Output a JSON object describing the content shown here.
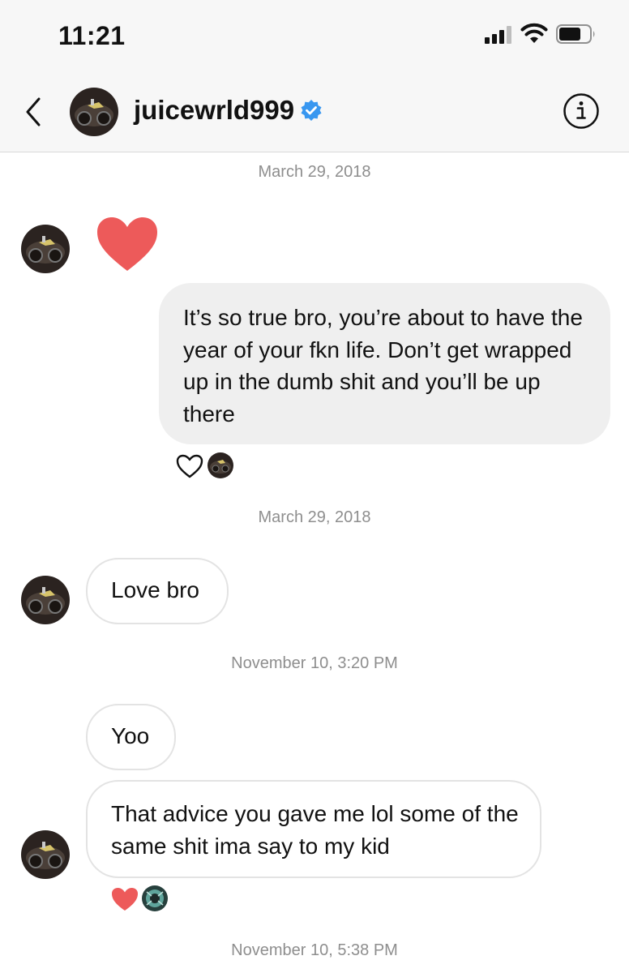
{
  "status_bar": {
    "time": "11:21"
  },
  "header": {
    "username": "juicewrld999",
    "verified": true,
    "back_icon": "chevron-left-icon",
    "info_icon": "info-icon"
  },
  "conversation": {
    "dates": [
      "March 29, 2018",
      "March 29, 2018",
      "November 10, 3:20 PM",
      "November 10, 5:38 PM"
    ],
    "messages": [
      {
        "sender": "them",
        "type": "heart",
        "icon": "heart-icon"
      },
      {
        "sender": "me",
        "type": "text",
        "text": "It’s so true bro, you’re about to have the year of your fkn life. Don’t get wrapped up in the dumb shit and you’ll be up there",
        "reaction": "heart-outline"
      },
      {
        "sender": "them",
        "type": "text",
        "text": "Love bro"
      },
      {
        "sender": "them",
        "type": "text",
        "text": "Yoo"
      },
      {
        "sender": "them",
        "type": "text",
        "text": "That advice you gave me lol some of the same shit ima say to my kid",
        "reaction": "heart-red"
      }
    ]
  },
  "colors": {
    "heart": "#ed5a5a",
    "verified": "#3897f0",
    "bubble_out": "#efefef",
    "bubble_border": "#e3e3e3",
    "date_text": "#8e8e8e"
  }
}
